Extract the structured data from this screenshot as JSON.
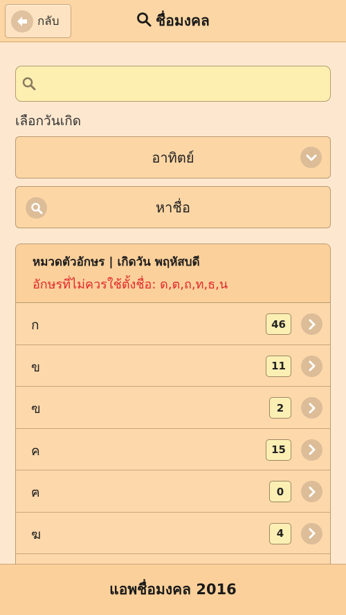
{
  "header": {
    "back_label": "กลับ",
    "title": "ชื่อมงคล"
  },
  "search": {
    "value": "",
    "placeholder": ""
  },
  "dob": {
    "label": "เลือกวันเกิด",
    "selected": "อาทิตย์"
  },
  "find_button": {
    "label": "หาชื่อ"
  },
  "panel": {
    "heading": "หมวดตัวอักษร | เกิดวัน พฤหัสบดี",
    "warning": "อักษรที่ไม่ควรใช้ตั้งชื่อ: ด,ต,ถ,ท,ธ,น",
    "rows": [
      {
        "letter": "ก",
        "count": "46"
      },
      {
        "letter": "ข",
        "count": "11"
      },
      {
        "letter": "ฃ",
        "count": "2"
      },
      {
        "letter": "ค",
        "count": "15"
      },
      {
        "letter": "ฅ",
        "count": "0"
      },
      {
        "letter": "ฆ",
        "count": "4"
      },
      {
        "letter": "",
        "count": ""
      }
    ]
  },
  "footer": {
    "title": "แอพชื่อมงคล 2016"
  },
  "colors": {
    "header_bg": "#fcd6a4",
    "page_bg": "#fde8cf",
    "warning": "#e0282c",
    "badge_bg": "#fcefb4"
  }
}
